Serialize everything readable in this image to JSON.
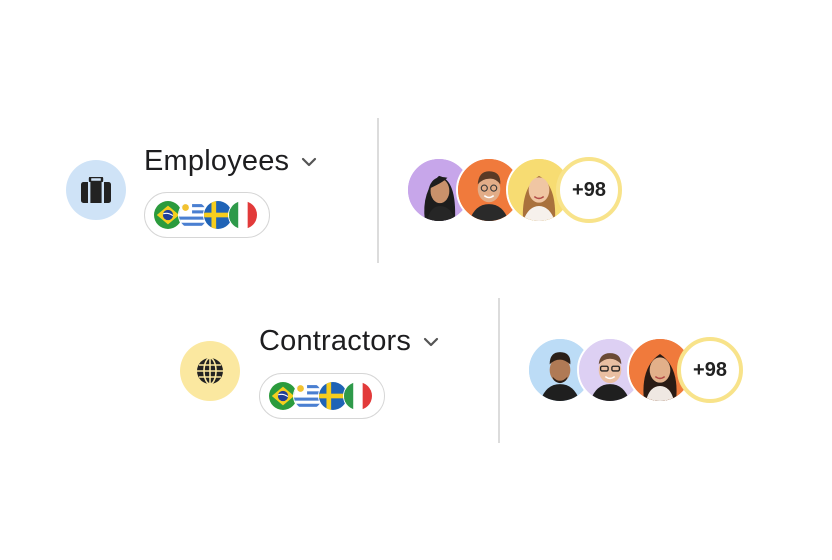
{
  "groups": [
    {
      "title": "Employees",
      "icon": "briefcase-icon",
      "icon_bg": "#cfe3f7",
      "flags": [
        "brazil-flag",
        "uruguay-flag",
        "sweden-flag",
        "italy-flag"
      ],
      "avatar_colors": [
        "#c7a6ea",
        "#f07a3c",
        "#f7dc72"
      ],
      "more_count": "+98"
    },
    {
      "title": "Contractors",
      "icon": "globe-icon",
      "icon_bg": "#fbe8a0",
      "flags": [
        "brazil-flag",
        "uruguay-flag",
        "sweden-flag",
        "italy-flag"
      ],
      "avatar_colors": [
        "#bcdcf6",
        "#ddd0f3",
        "#f07a3c"
      ],
      "more_count": "+98"
    }
  ],
  "colors": {
    "badge_ring": "#f8e38a",
    "divider": "#dcdcdc",
    "pill_border": "#d6d6d6"
  }
}
